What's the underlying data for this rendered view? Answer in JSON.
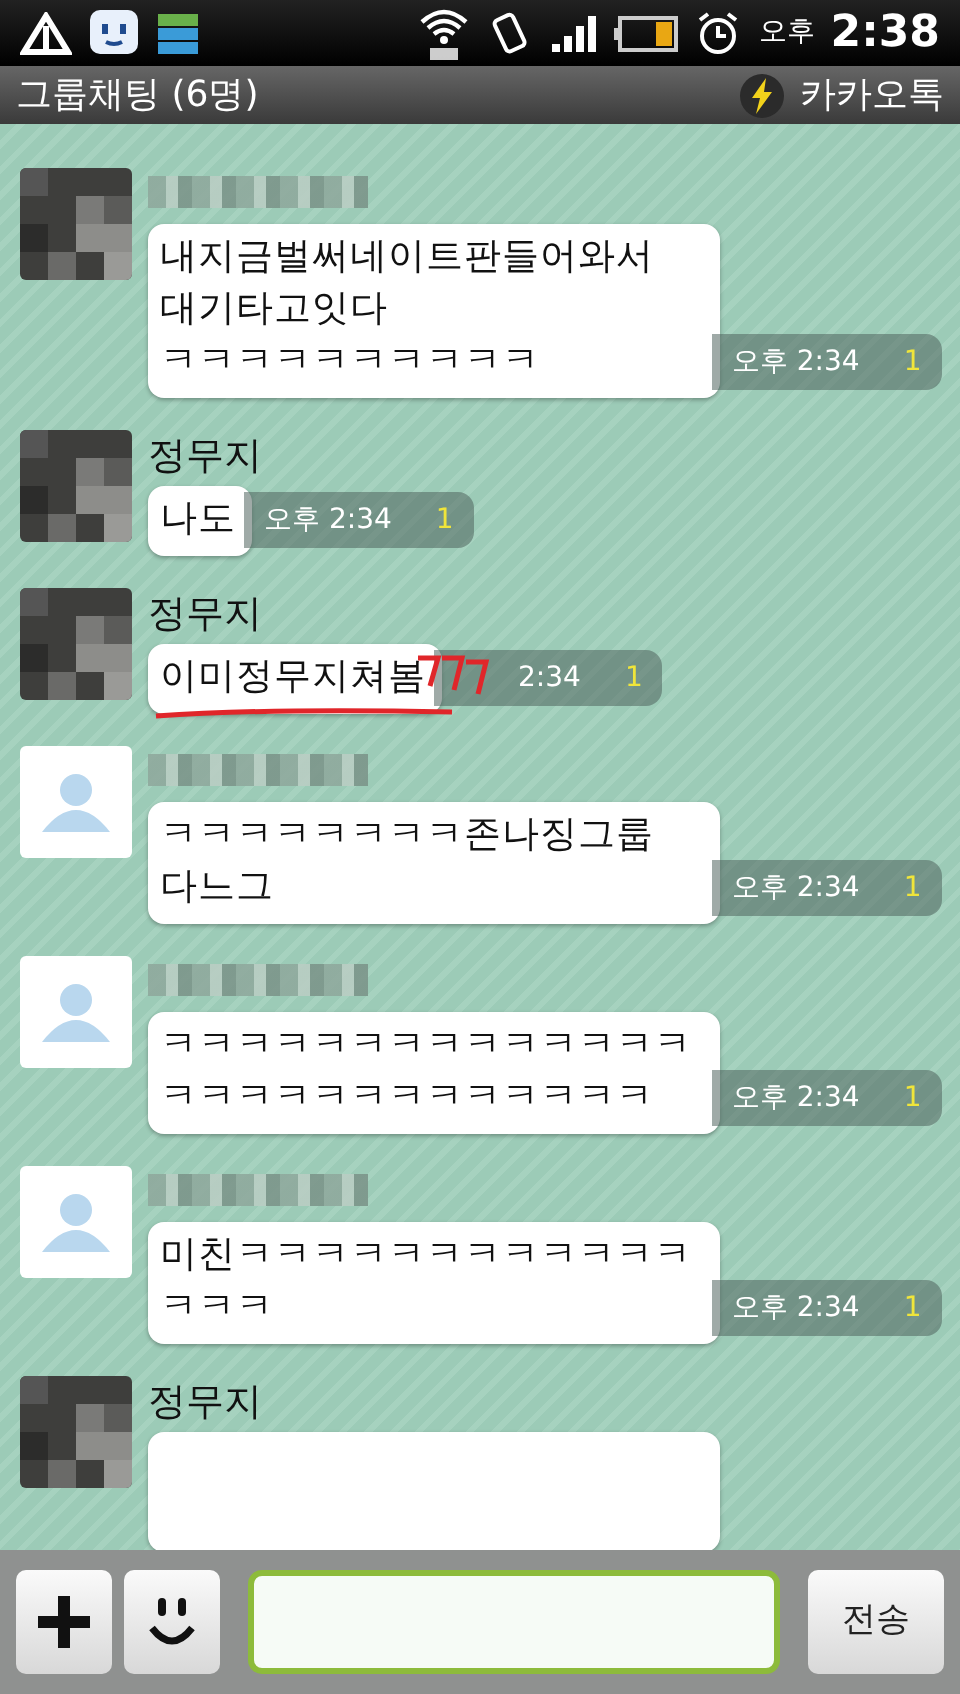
{
  "status_bar": {
    "ampm": "오후",
    "time": "2:38"
  },
  "header": {
    "title": "그룹채팅 (6명)",
    "app_name": "카카오톡"
  },
  "messages": [
    {
      "default_avatar": false,
      "name_blurred": true,
      "text": "내지금벌써네이트판들어와서\n대기타고잇다\nㅋㅋㅋㅋㅋㅋㅋㅋㅋㅋ",
      "time": "오후 2:34",
      "unread": "1"
    },
    {
      "default_avatar": false,
      "sender": "정무지",
      "text": "나도",
      "time": "오후 2:34",
      "unread": "1"
    },
    {
      "default_avatar": false,
      "sender": "정무지",
      "text": "이미정무지쳐봄",
      "time": "2:34",
      "unread": "1",
      "annotated": true
    },
    {
      "default_avatar": true,
      "name_blurred": true,
      "text": "ㅋㅋㅋㅋㅋㅋㅋㅋ존나징그룹\n다느그",
      "time": "오후 2:34",
      "unread": "1"
    },
    {
      "default_avatar": true,
      "name_blurred": true,
      "text": "ㅋㅋㅋㅋㅋㅋㅋㅋㅋㅋㅋㅋㅋㅋㅋㅋㅋㅋㅋㅋㅋㅋㅋㅋㅋㅋㅋ",
      "time": "오후 2:34",
      "unread": "1"
    },
    {
      "default_avatar": true,
      "name_blurred": true,
      "text": "미친ㅋㅋㅋㅋㅋㅋㅋㅋㅋㅋㅋㅋㅋㅋㅋ",
      "time": "오후 2:34",
      "unread": "1"
    },
    {
      "default_avatar": false,
      "sender": "정무지",
      "cut_off": true
    }
  ],
  "composer": {
    "send_label": "전송"
  }
}
